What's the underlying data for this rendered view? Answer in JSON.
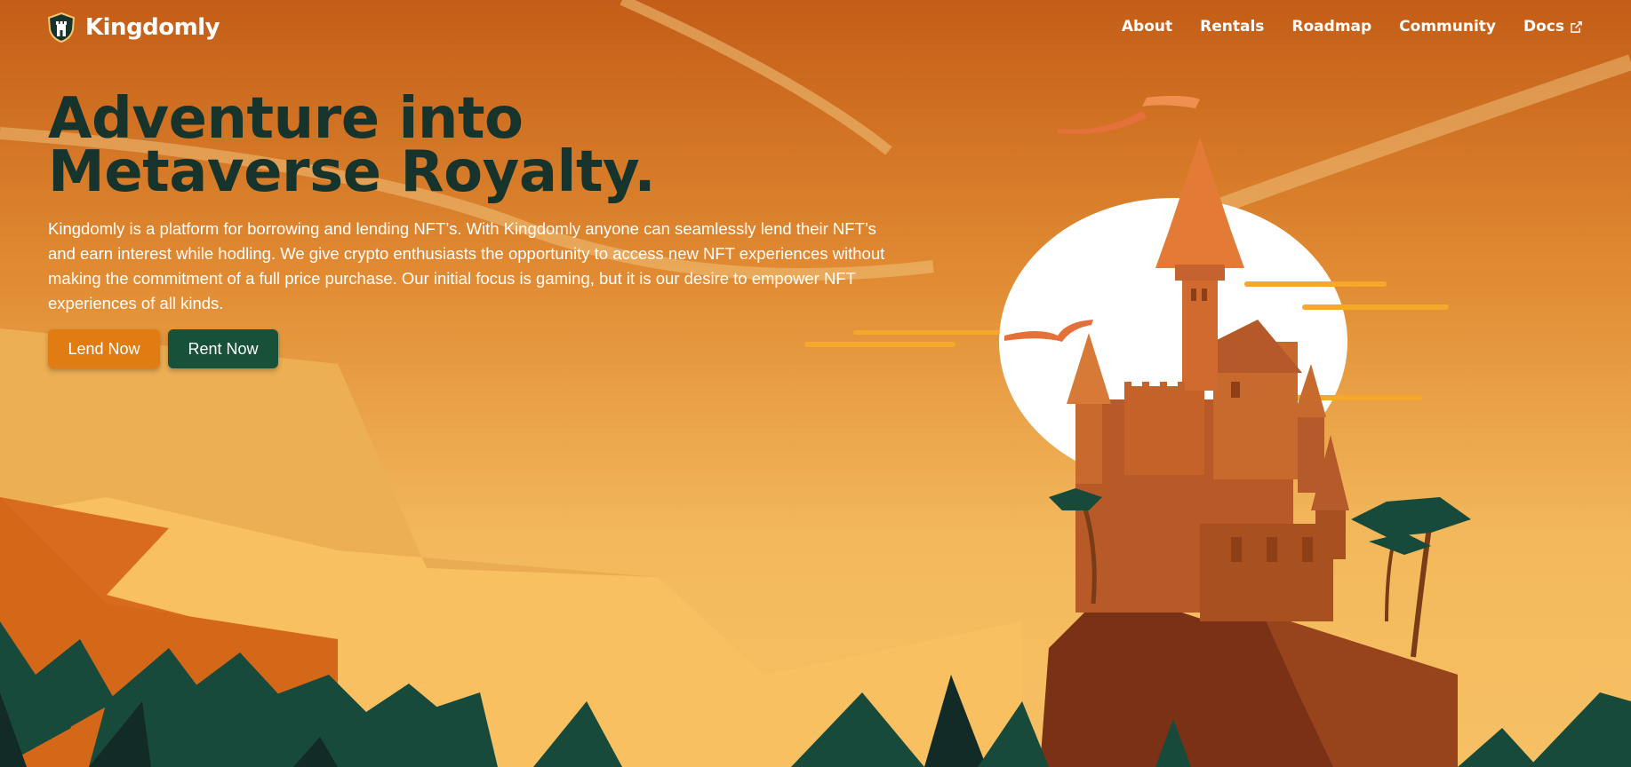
{
  "brand": {
    "name": "Kingdomly",
    "logo_icon": "shield-castle-icon"
  },
  "nav": {
    "items": [
      {
        "label": "About"
      },
      {
        "label": "Rentals"
      },
      {
        "label": "Roadmap"
      },
      {
        "label": "Community"
      },
      {
        "label": "Docs",
        "icon": "external-link-icon"
      }
    ]
  },
  "hero": {
    "title": "Adventure into Metaverse Royalty.",
    "description": "Kingdomly is a platform for borrowing and lending NFT’s. With Kingdomly anyone can seamlessly lend their NFT’s and earn interest while hodling. We give crypto enthusiasts the opportunity to access new NFT experiences without making the commitment of a full price purchase. Our initial focus is gaming, but it is our desire to empower NFT experiences of all kinds.",
    "buttons": {
      "lend": "Lend Now",
      "rent": "Rent Now"
    }
  },
  "colors": {
    "sky_top": "#c45f18",
    "sky_bottom": "#f2b35a",
    "title": "#17342c",
    "lend_button": "#e07c12",
    "rent_button": "#17513a",
    "pine": "#174a3a",
    "castle": "#c8632a",
    "moon": "#ffffff"
  }
}
